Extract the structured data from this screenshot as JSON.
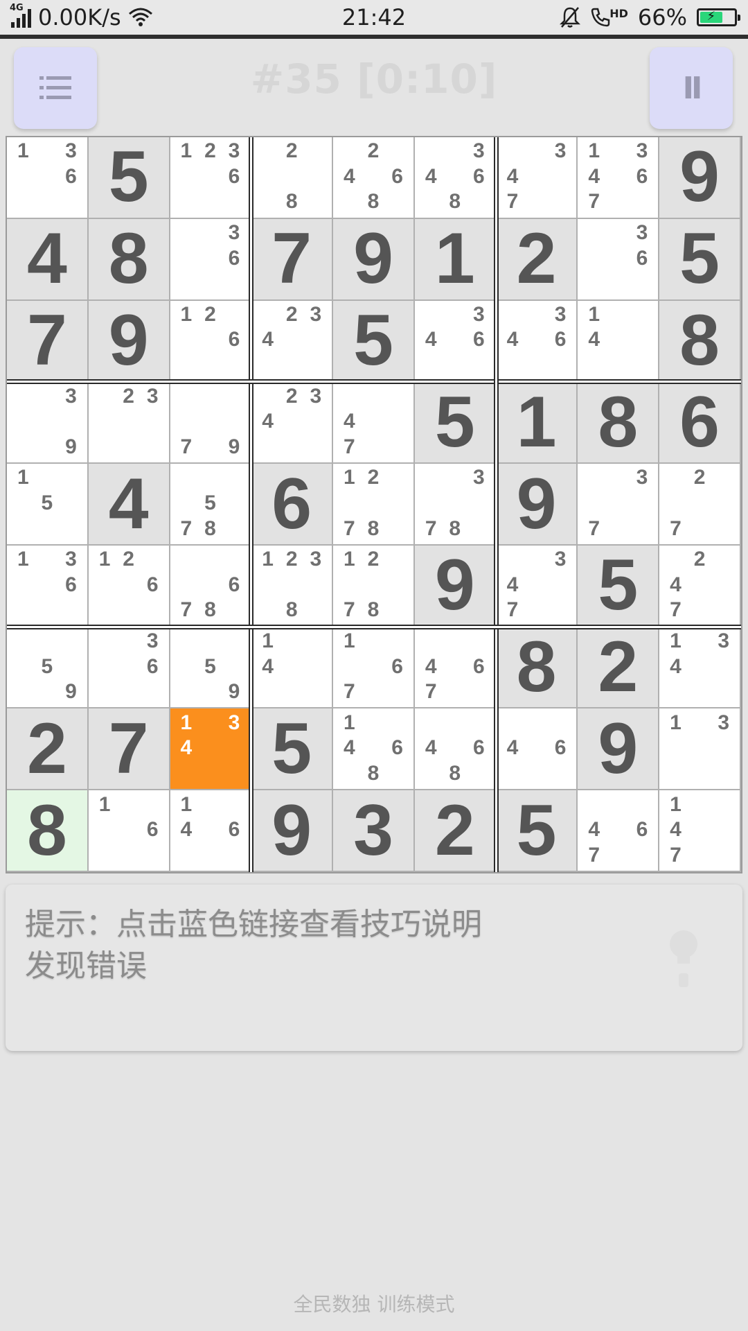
{
  "status_bar": {
    "network_type": "4G",
    "net_speed": "0.00K/s",
    "time": "21:42",
    "call_tag": "HD",
    "battery_percent": "66%",
    "battery_level": 0.66,
    "battery_color": "#2ad67a"
  },
  "header": {
    "title": "#35 [0:10]",
    "menu_icon": "list-icon",
    "pause_label": "II"
  },
  "board": {
    "selected_color": "#fb8f1d",
    "given_bg": "#e2e2e2",
    "rows": [
      [
        {
          "c": [
            1,
            3,
            6
          ]
        },
        {
          "v": 5,
          "g": true
        },
        {
          "c": [
            1,
            2,
            3,
            6
          ]
        },
        {
          "c": [
            2,
            8
          ]
        },
        {
          "c": [
            2,
            4,
            6,
            8
          ]
        },
        {
          "c": [
            3,
            4,
            6,
            8
          ]
        },
        {
          "c": [
            3,
            4,
            7
          ]
        },
        {
          "c": [
            1,
            3,
            4,
            6,
            7
          ]
        },
        {
          "v": 9,
          "g": true
        }
      ],
      [
        {
          "v": 4,
          "g": true
        },
        {
          "v": 8,
          "g": true
        },
        {
          "c": [
            3,
            6
          ]
        },
        {
          "v": 7,
          "g": true
        },
        {
          "v": 9,
          "g": true
        },
        {
          "v": 1,
          "g": true
        },
        {
          "v": 2,
          "g": true
        },
        {
          "c": [
            3,
            6
          ]
        },
        {
          "v": 5,
          "g": true
        }
      ],
      [
        {
          "v": 7,
          "g": true
        },
        {
          "v": 9,
          "g": true
        },
        {
          "c": [
            1,
            2,
            6
          ]
        },
        {
          "c": [
            2,
            3,
            4
          ]
        },
        {
          "v": 5,
          "g": true
        },
        {
          "c": [
            3,
            4,
            6
          ]
        },
        {
          "c": [
            3,
            4,
            6
          ]
        },
        {
          "c": [
            1,
            4
          ]
        },
        {
          "v": 8,
          "g": true
        }
      ],
      [
        {
          "c": [
            3,
            9
          ]
        },
        {
          "c": [
            2,
            3
          ]
        },
        {
          "c": [
            7,
            9
          ]
        },
        {
          "c": [
            2,
            3,
            4
          ]
        },
        {
          "c": [
            4,
            7
          ]
        },
        {
          "v": 5,
          "g": true
        },
        {
          "v": 1,
          "g": true
        },
        {
          "v": 8,
          "g": true
        },
        {
          "v": 6,
          "g": true
        }
      ],
      [
        {
          "c": [
            1,
            5
          ]
        },
        {
          "v": 4,
          "g": true
        },
        {
          "c": [
            5,
            7,
            8
          ]
        },
        {
          "v": 6,
          "g": true
        },
        {
          "c": [
            1,
            2,
            7,
            8
          ]
        },
        {
          "c": [
            3,
            7,
            8
          ]
        },
        {
          "v": 9,
          "g": true
        },
        {
          "c": [
            3,
            7
          ]
        },
        {
          "c": [
            2,
            7
          ]
        }
      ],
      [
        {
          "c": [
            1,
            3,
            6
          ]
        },
        {
          "c": [
            1,
            2,
            6
          ]
        },
        {
          "c": [
            6,
            7,
            8
          ]
        },
        {
          "c": [
            1,
            2,
            3,
            8
          ]
        },
        {
          "c": [
            1,
            2,
            7,
            8
          ]
        },
        {
          "v": 9,
          "g": true
        },
        {
          "c": [
            3,
            4,
            7
          ]
        },
        {
          "v": 5,
          "g": true
        },
        {
          "c": [
            2,
            4,
            7
          ]
        }
      ],
      [
        {
          "c": [
            5,
            9
          ]
        },
        {
          "c": [
            3,
            6
          ]
        },
        {
          "c": [
            5,
            9
          ]
        },
        {
          "c": [
            1,
            4
          ]
        },
        {
          "c": [
            1,
            6,
            7
          ]
        },
        {
          "c": [
            4,
            6,
            7
          ]
        },
        {
          "v": 8,
          "g": true
        },
        {
          "v": 2,
          "g": true
        },
        {
          "c": [
            1,
            3,
            4
          ]
        }
      ],
      [
        {
          "v": 2,
          "g": true
        },
        {
          "v": 7,
          "g": true
        },
        {
          "c": [
            1,
            3,
            4
          ],
          "sel": true
        },
        {
          "v": 5,
          "g": true
        },
        {
          "c": [
            1,
            4,
            6,
            8
          ]
        },
        {
          "c": [
            4,
            6,
            8
          ]
        },
        {
          "c": [
            4,
            6
          ]
        },
        {
          "v": 9,
          "g": true
        },
        {
          "c": [
            1,
            3
          ]
        }
      ],
      [
        {
          "v": 8,
          "hl": true
        },
        {
          "c": [
            1,
            6
          ]
        },
        {
          "c": [
            1,
            4,
            6
          ]
        },
        {
          "v": 9,
          "g": true
        },
        {
          "v": 3,
          "g": true
        },
        {
          "v": 2,
          "g": true
        },
        {
          "v": 5,
          "g": true
        },
        {
          "c": [
            4,
            6,
            7
          ]
        },
        {
          "c": [
            1,
            4,
            7
          ]
        }
      ]
    ]
  },
  "hint": {
    "line1": "提示：点击蓝色链接查看技巧说明",
    "line2": "发现错误",
    "icon": "lightbulb-icon"
  },
  "footer": {
    "mode": "全民数独 训练模式"
  }
}
